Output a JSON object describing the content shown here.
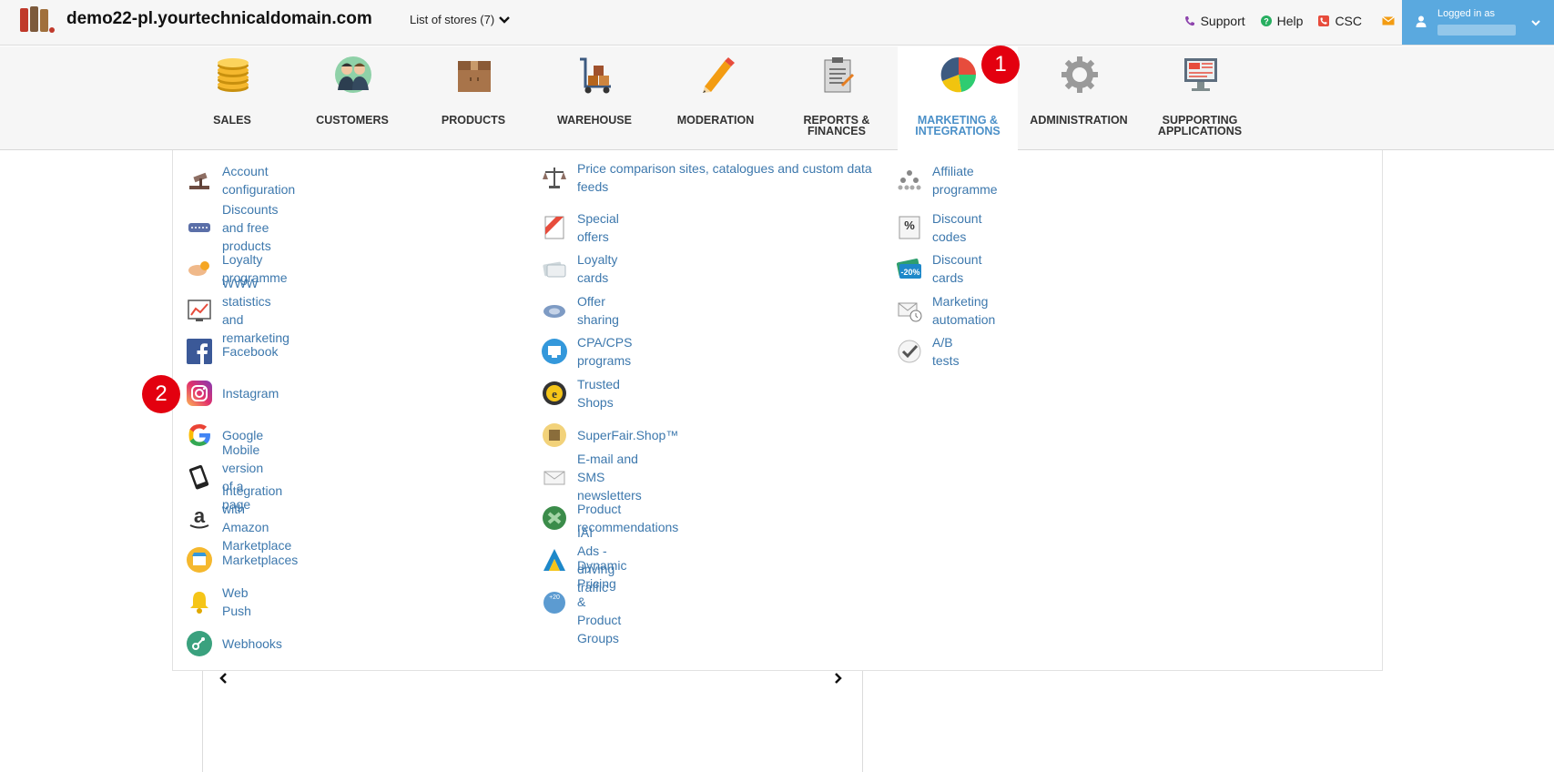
{
  "header": {
    "domain": "demo22-pl.yourtechnicaldomain.com",
    "stores_label": "List of stores (7)",
    "links": [
      {
        "label": "Support",
        "icon": "phone-icon",
        "color": "#8e44ad"
      },
      {
        "label": "Help",
        "icon": "help-icon",
        "color": "#27ae60"
      },
      {
        "label": "CSC",
        "icon": "phone-box-icon",
        "color": "#e74c3c"
      }
    ],
    "mail_icon": "mail-icon",
    "user": {
      "logged_in_label": "Logged in as"
    }
  },
  "modules": [
    {
      "label": "SALES",
      "icon": "coins-icon"
    },
    {
      "label": "CUSTOMERS",
      "icon": "customers-icon"
    },
    {
      "label": "PRODUCTS",
      "icon": "box-icon"
    },
    {
      "label": "WAREHOUSE",
      "icon": "cart-icon"
    },
    {
      "label": "MODERATION",
      "icon": "pencil-icon"
    },
    {
      "label": "REPORTS & FINANCES",
      "icon": "clipboard-icon"
    },
    {
      "label": "MARKETING & INTEGRATIONS",
      "icon": "pie-chart-icon"
    },
    {
      "label": "ADMINISTRATION",
      "icon": "gear-icon"
    },
    {
      "label": "SUPPORTING APPLICATIONS",
      "icon": "monitor-icon"
    }
  ],
  "badges": [
    "1",
    "2"
  ],
  "menu": {
    "col1": [
      {
        "label": "Account configuration",
        "icon": "gavel-icon"
      },
      {
        "label": "Discounts and free products",
        "icon": "discount-icon"
      },
      {
        "label": "Loyalty programme",
        "icon": "hands-icon"
      },
      {
        "label": "WWW statistics and remarketing",
        "icon": "stats-icon"
      },
      {
        "label": "Facebook",
        "icon": "facebook-icon"
      },
      {
        "label": "Instagram",
        "icon": "instagram-icon"
      },
      {
        "label": "Google",
        "icon": "google-icon"
      },
      {
        "label": "Mobile version of a page",
        "icon": "mobile-icon"
      },
      {
        "label": "Integration with Amazon Marketplace",
        "icon": "amazon-icon"
      },
      {
        "label": "Marketplaces",
        "icon": "marketplace-icon"
      },
      {
        "label": "Web Push",
        "icon": "bell-icon"
      },
      {
        "label": "Webhooks",
        "icon": "webhook-icon"
      }
    ],
    "col2": [
      {
        "label": "Price comparison sites, catalogues and custom data feeds",
        "icon": "scales-icon"
      },
      {
        "label": "Special offers",
        "icon": "special-offer-icon"
      },
      {
        "label": "Loyalty cards",
        "icon": "loyalty-card-icon"
      },
      {
        "label": "Offer sharing",
        "icon": "share-icon"
      },
      {
        "label": "CPA/CPS programs",
        "icon": "cpa-icon"
      },
      {
        "label": "Trusted Shops",
        "icon": "trusted-shops-icon"
      },
      {
        "label": "SuperFair.Shop™",
        "icon": "superfair-icon"
      },
      {
        "label": "E-mail and SMS newsletters",
        "icon": "newsletter-icon"
      },
      {
        "label": "Product recommendations",
        "icon": "recommendation-icon"
      },
      {
        "label": "IAI Ads - driving traffic",
        "icon": "ads-icon"
      },
      {
        "label": "Dynamic Pricing & Product Groups",
        "icon": "dynamic-pricing-icon"
      }
    ],
    "col3": [
      {
        "label": "Affiliate programme",
        "icon": "affiliate-icon"
      },
      {
        "label": "Discount codes",
        "icon": "percent-icon"
      },
      {
        "label": "Discount cards",
        "icon": "discount-card-icon"
      },
      {
        "label": "Marketing automation",
        "icon": "automation-icon"
      },
      {
        "label": "A/B tests",
        "icon": "ab-test-icon"
      }
    ]
  }
}
